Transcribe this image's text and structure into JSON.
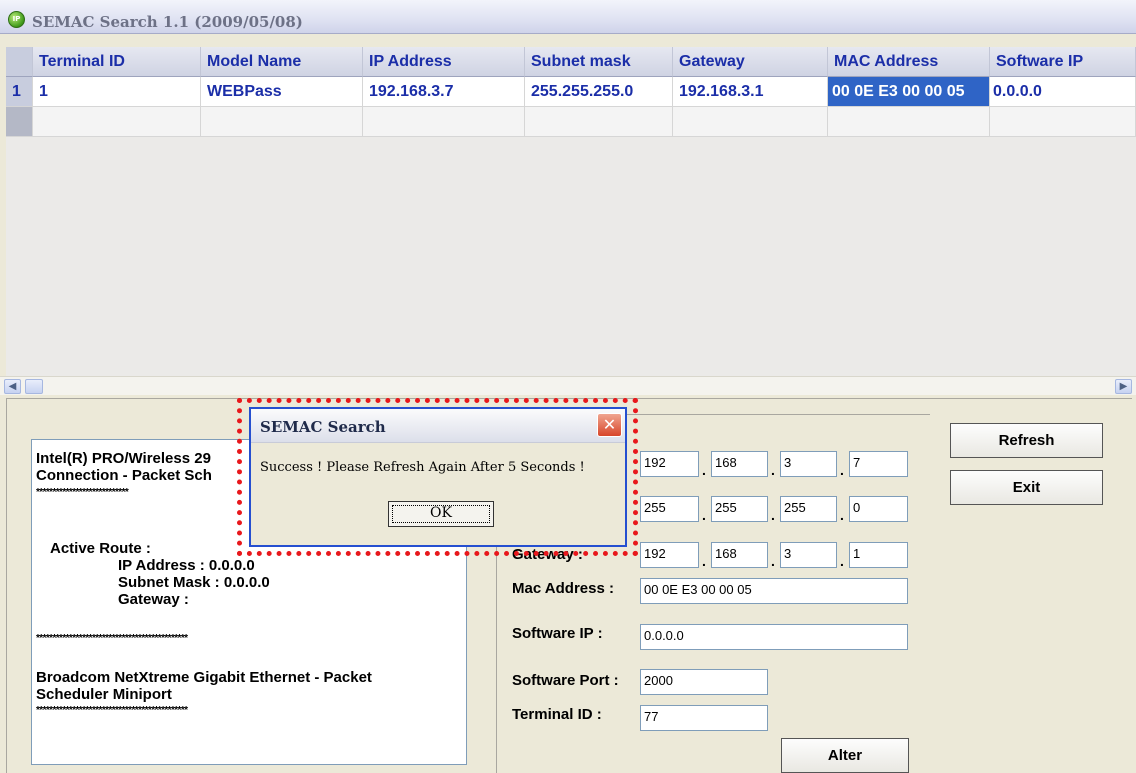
{
  "window": {
    "title": "SEMAC Search 1.1 (2009/05/08)",
    "icon_name": "app-ip-icon",
    "icon_text": "IP"
  },
  "table": {
    "columns": [
      "Terminal ID",
      "Model Name",
      "IP Address",
      "Subnet mask",
      "Gateway",
      "MAC Address",
      "Software IP"
    ],
    "rows": [
      {
        "index": "1",
        "cells": [
          "1",
          "WEBPass",
          "192.168.3.7",
          "255.255.255.0",
          "192.168.3.1",
          "00 0E E3 00 00 05",
          "0.0.0.0"
        ]
      }
    ],
    "selected_column": "MAC Address"
  },
  "network_log": {
    "lines": [
      "Intel(R) PRO/Wireless 29",
      "Connection - Packet Sch",
      "****************************",
      "Active Route :",
      "IP Address : 0.0.0.0",
      "Subnet Mask : 0.0.0.0",
      "Gateway :",
      "**********************************************",
      "Broadcom NetXtreme Gigabit Ethernet - Packet",
      "Scheduler Miniport",
      "**********************************************"
    ]
  },
  "form": {
    "ip_octets": [
      "192",
      "168",
      "3",
      "7"
    ],
    "subnet_octets": [
      "255",
      "255",
      "255",
      "0"
    ],
    "gateway_label": "Gateway :",
    "gateway_octets": [
      "192",
      "168",
      "3",
      "1"
    ],
    "mac_label": "Mac Address :",
    "mac_value": "00 0E E3 00 00 05",
    "software_ip_label": "Software IP :",
    "software_ip_value": "0.0.0.0",
    "software_port_label": "Software Port :",
    "software_port_value": "2000",
    "terminal_id_label": "Terminal ID :",
    "terminal_id_value": "77",
    "alter_label": "Alter"
  },
  "buttons": {
    "refresh": "Refresh",
    "exit": "Exit"
  },
  "dialog": {
    "title": "SEMAC Search",
    "message": "Success ! Please Refresh Again After 5 Seconds !",
    "ok_label": "OK",
    "close_glyph": "✕"
  },
  "colors": {
    "highlight_outline": "#e8181c",
    "selection": "#2f64c6",
    "header_text": "#1b2ea8"
  }
}
